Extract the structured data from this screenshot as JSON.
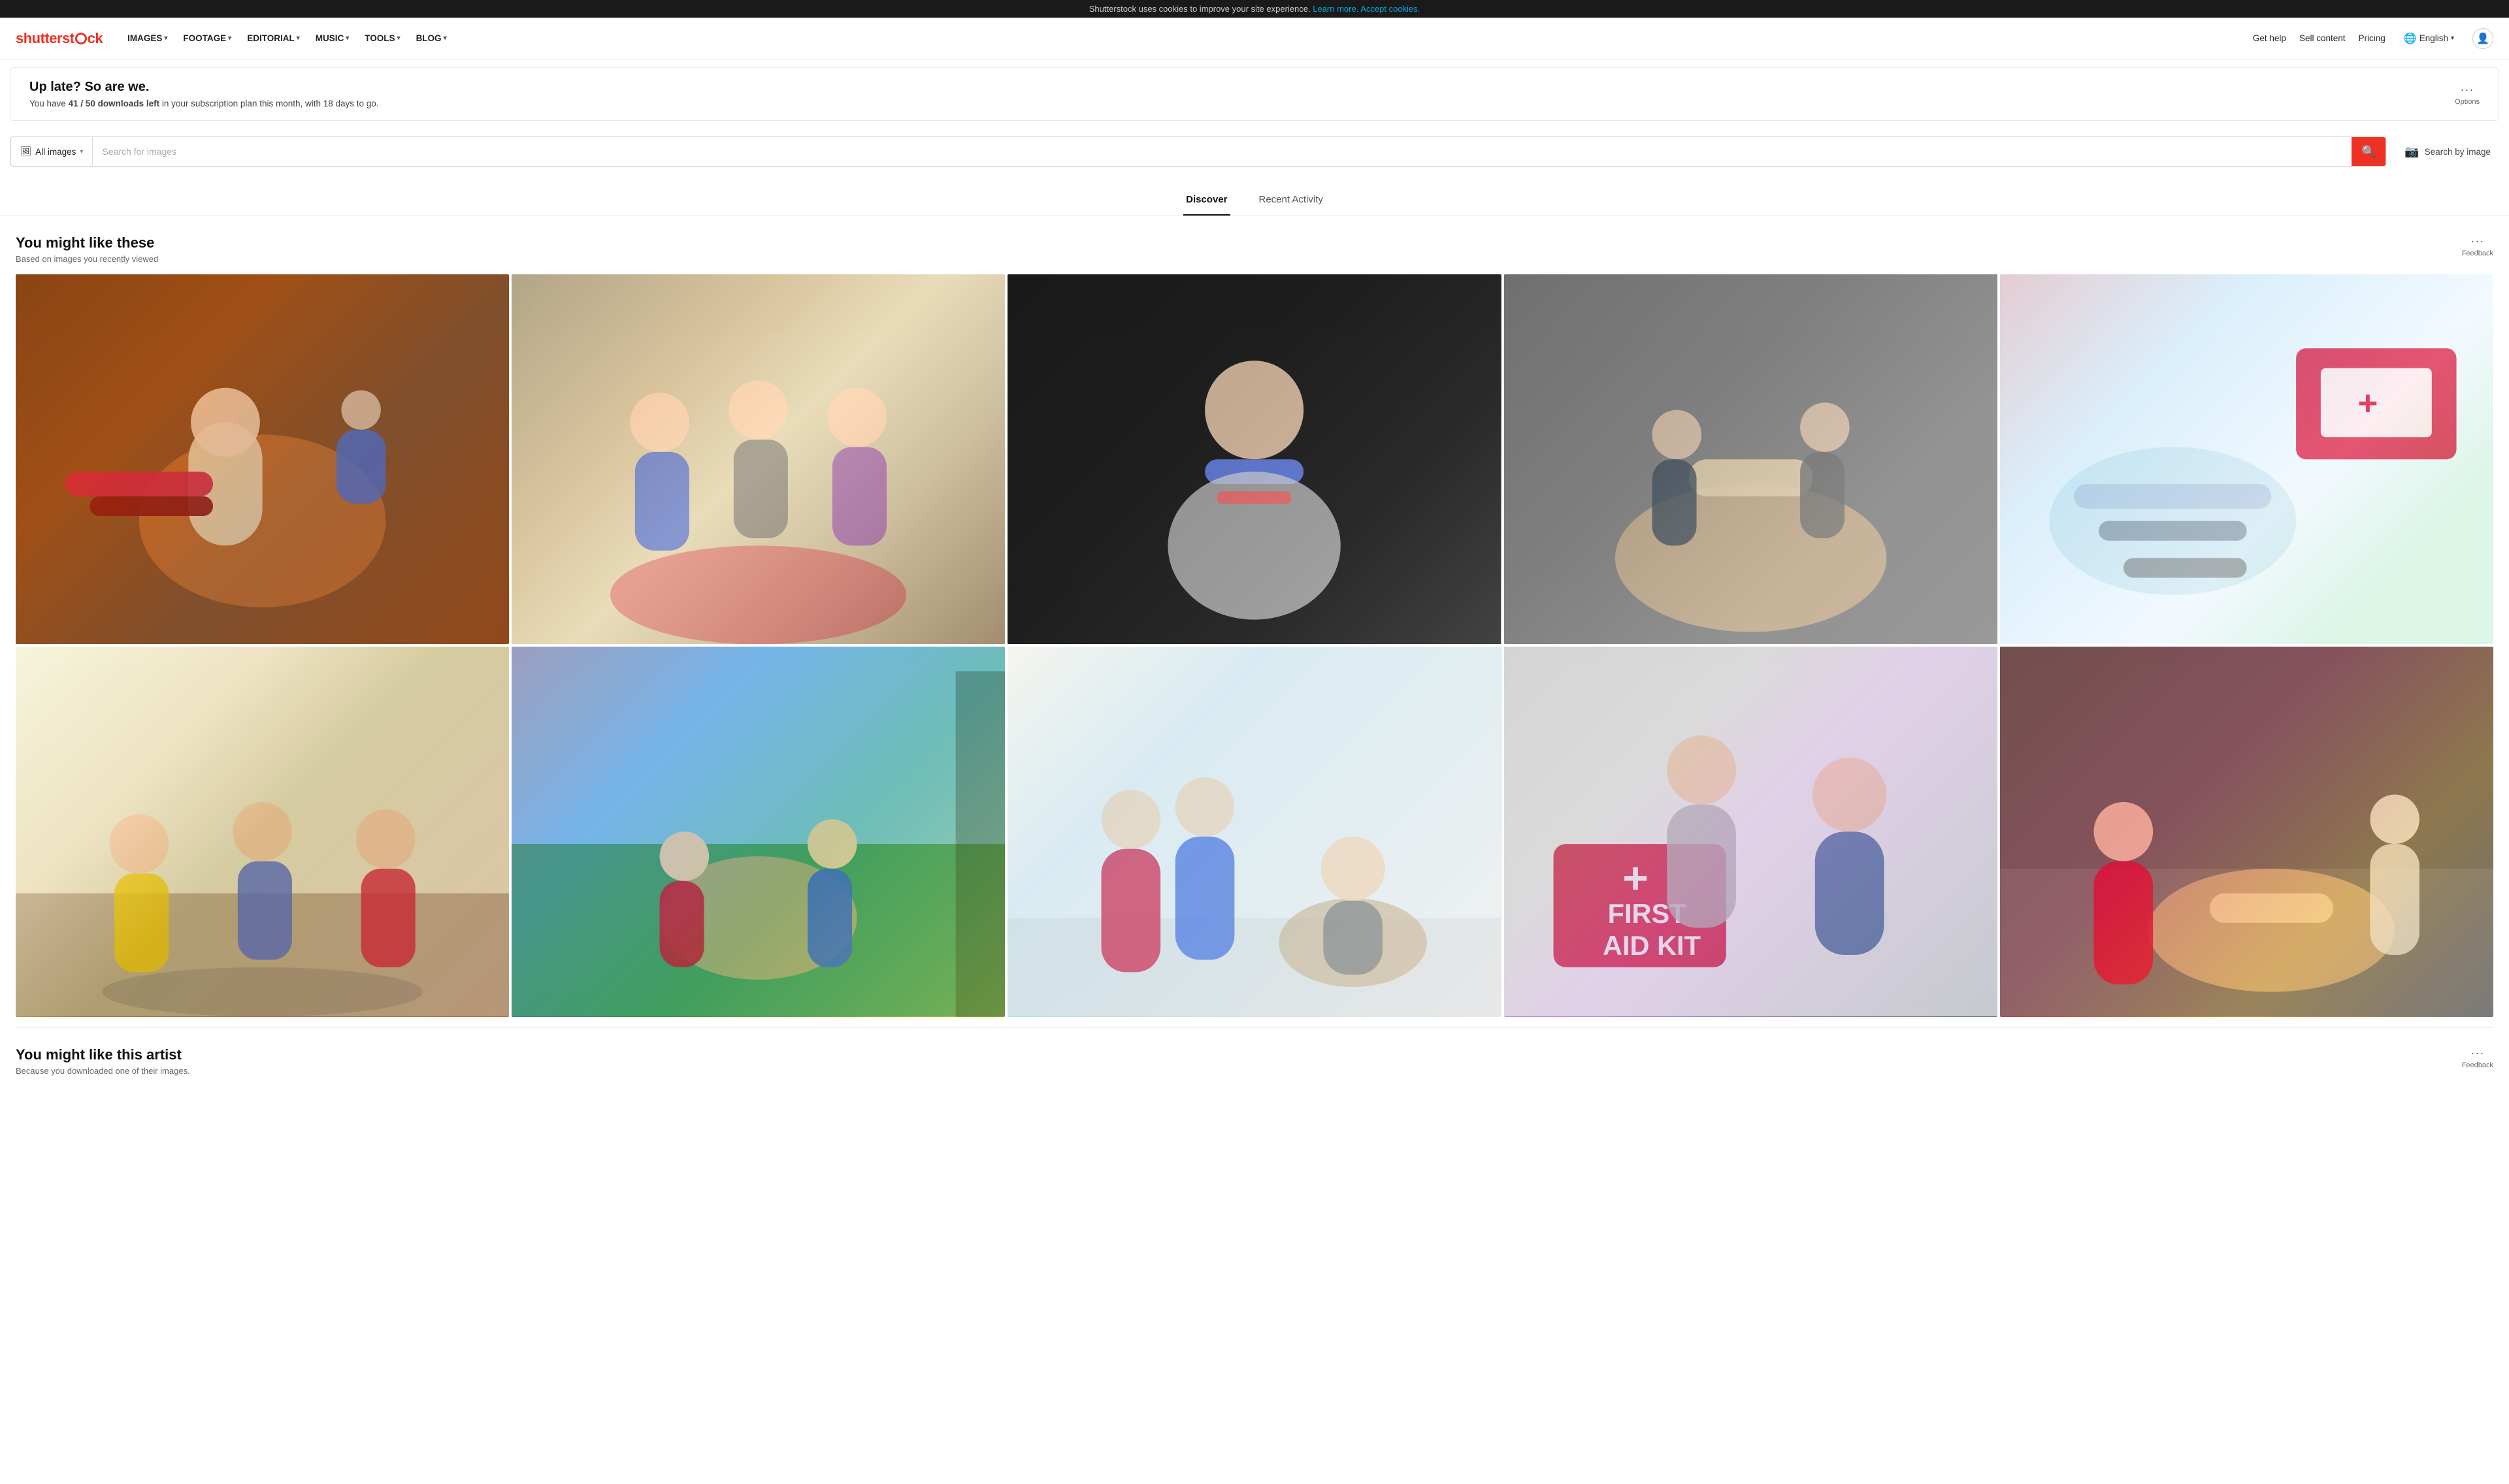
{
  "cookie": {
    "text": "Shutterstock uses cookies to improve your site experience.",
    "learn_more": "Learn more.",
    "accept": "Accept cookies."
  },
  "header": {
    "logo_text1": "shutterst",
    "logo_text2": "ck",
    "nav": [
      {
        "label": "IMAGES",
        "has_dropdown": true
      },
      {
        "label": "FOOTAGE",
        "has_dropdown": true
      },
      {
        "label": "EDITORIAL",
        "has_dropdown": true
      },
      {
        "label": "MUSIC",
        "has_dropdown": true
      },
      {
        "label": "TOOLS",
        "has_dropdown": true
      },
      {
        "label": "BLOG",
        "has_dropdown": true
      }
    ],
    "right_links": [
      {
        "label": "Get help"
      },
      {
        "label": "Sell content"
      },
      {
        "label": "Pricing"
      }
    ],
    "language": "English"
  },
  "notification": {
    "title": "Up late? So are we.",
    "text_before": "You have ",
    "highlight": "41 / 50 downloads left",
    "text_after": " in your subscription plan this month, with 18 days to go.",
    "options_label": "Options"
  },
  "search": {
    "type_label": "All images",
    "placeholder": "Search for images",
    "search_by_image_label": "Search by image"
  },
  "tabs": [
    {
      "label": "Discover",
      "active": true
    },
    {
      "label": "Recent Activity",
      "active": false
    }
  ],
  "section1": {
    "title": "You might like these",
    "subtitle": "Based on images you recently viewed",
    "feedback_label": "Feedback",
    "images": [
      {
        "id": 1,
        "color": "c1",
        "alt": "CPR training on mannequin"
      },
      {
        "id": 2,
        "color": "c2",
        "alt": "Group CPR training"
      },
      {
        "id": 3,
        "color": "c3",
        "alt": "Baby CPR demonstration"
      },
      {
        "id": 4,
        "color": "c4",
        "alt": "CPR chest compressions"
      },
      {
        "id": 5,
        "color": "c5",
        "alt": "First aid kit"
      },
      {
        "id": 6,
        "color": "c6",
        "alt": "CPR group class"
      },
      {
        "id": 7,
        "color": "c7",
        "alt": "Outdoor first aid"
      },
      {
        "id": 8,
        "color": "c9",
        "alt": "CPR on person"
      },
      {
        "id": 9,
        "color": "c10",
        "alt": "First aid kit usage"
      },
      {
        "id": 10,
        "color": "c11",
        "alt": "CPR on mannequin outdoor"
      }
    ]
  },
  "section2": {
    "title": "You might like this artist",
    "subtitle": "Because you downloaded one of their images.",
    "feedback_label": "Feedback"
  }
}
